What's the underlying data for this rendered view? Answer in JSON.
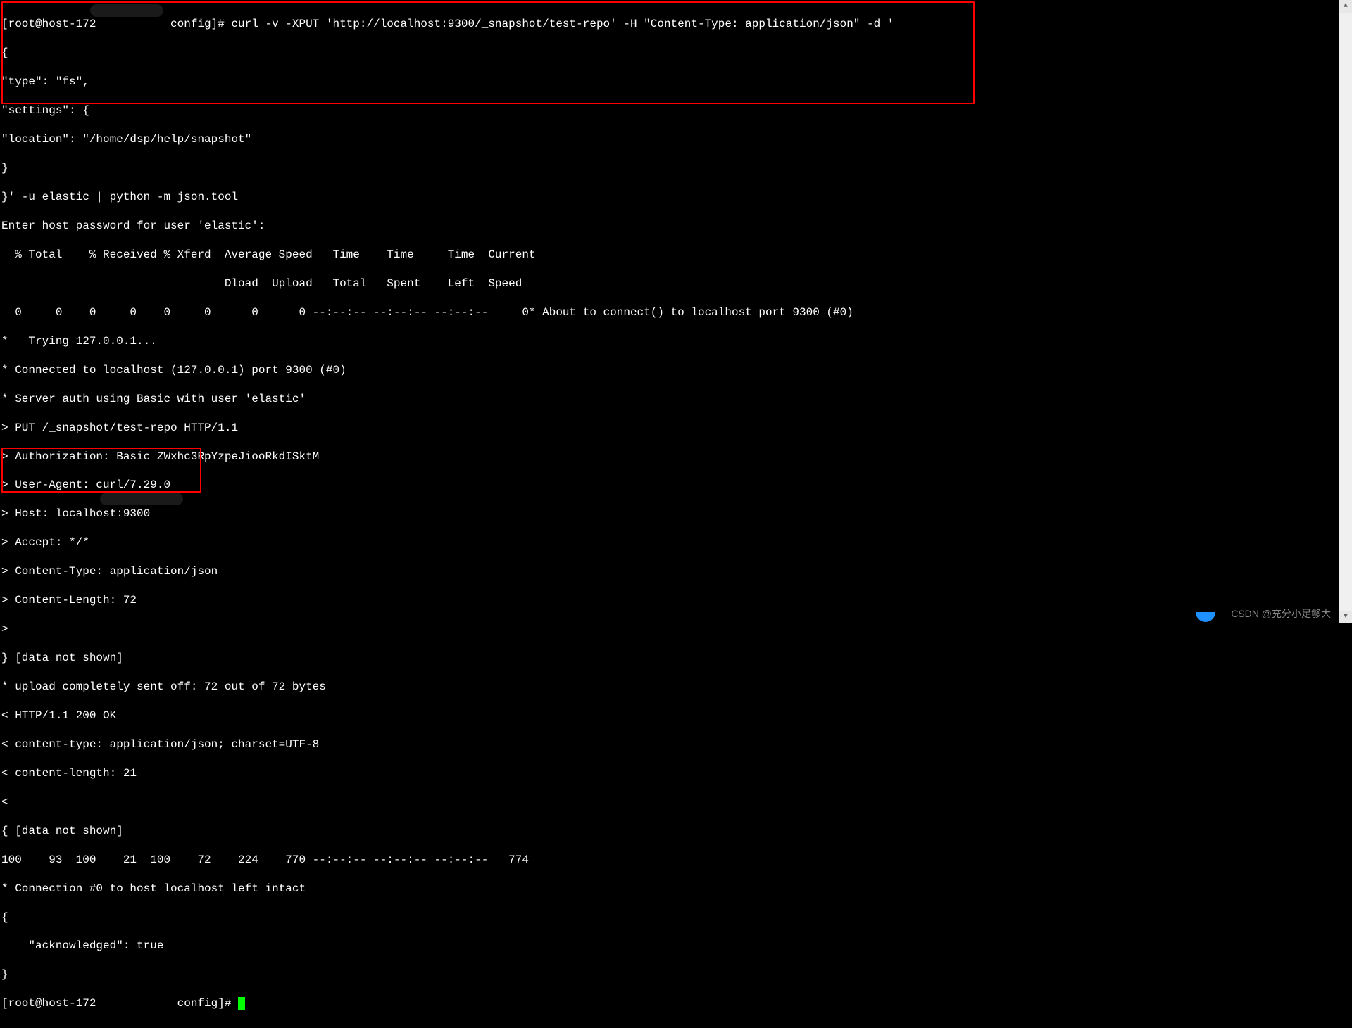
{
  "terminal": {
    "line01": "[root@host-172           config]# curl -v -XPUT 'http://localhost:9300/_snapshot/test-repo' -H \"Content-Type: application/json\" -d '",
    "line02": "{",
    "line03": "\"type\": \"fs\",",
    "line04": "\"settings\": {",
    "line05": "\"location\": \"/home/dsp/help/snapshot\"",
    "line06": "}",
    "line07": "}' -u elastic | python -m json.tool",
    "line08": "Enter host password for user 'elastic':",
    "line09": "  % Total    % Received % Xferd  Average Speed   Time    Time     Time  Current",
    "line10": "                                 Dload  Upload   Total   Spent    Left  Speed",
    "line11": "  0     0    0     0    0     0      0      0 --:--:-- --:--:-- --:--:--     0* About to connect() to localhost port 9300 (#0)",
    "line12": "*   Trying 127.0.0.1...",
    "line13": "* Connected to localhost (127.0.0.1) port 9300 (#0)",
    "line14": "* Server auth using Basic with user 'elastic'",
    "line15": "> PUT /_snapshot/test-repo HTTP/1.1",
    "line16": "> Authorization: Basic ZWxhc3RpYzpeJiooRkdISktM",
    "line17": "> User-Agent: curl/7.29.0",
    "line18": "> Host: localhost:9300",
    "line19": "> Accept: */*",
    "line20": "> Content-Type: application/json",
    "line21": "> Content-Length: 72",
    "line22": ">",
    "line23": "} [data not shown]",
    "line24": "* upload completely sent off: 72 out of 72 bytes",
    "line25": "< HTTP/1.1 200 OK",
    "line26": "< content-type: application/json; charset=UTF-8",
    "line27": "< content-length: 21",
    "line28": "<",
    "line29": "{ [data not shown]",
    "line30": "100    93  100    21  100    72    224    770 --:--:-- --:--:-- --:--:--   774",
    "line31": "* Connection #0 to host localhost left intact",
    "line32": "{",
    "line33": "    \"acknowledged\": true",
    "line34": "}",
    "line35": "[root@host-172            config]# "
  },
  "watermark": "CSDN @充分小足够大",
  "scrollbar": {
    "up": "▲",
    "down": "▼"
  }
}
